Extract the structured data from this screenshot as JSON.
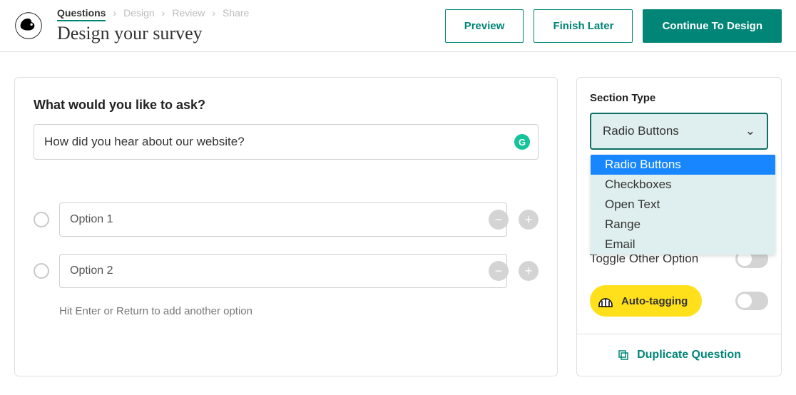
{
  "breadcrumb": {
    "steps": [
      "Questions",
      "Design",
      "Review",
      "Share"
    ],
    "active": 0
  },
  "title": "Design your survey",
  "actions": {
    "preview": "Preview",
    "later": "Finish Later",
    "continue": "Continue To Design"
  },
  "main": {
    "question_label": "What would you like to ask?",
    "question_value": "How did you hear about our website?",
    "options": [
      "Option 1",
      "Option 2"
    ],
    "hint": "Hit Enter or Return to add another option"
  },
  "side": {
    "section_type_label": "Section Type",
    "selected": "Radio Buttons",
    "items": [
      "Radio Buttons",
      "Checkboxes",
      "Open Text",
      "Range",
      "Email"
    ],
    "toggle_other": "Toggle Other Option",
    "auto_tag": "Auto-tagging",
    "duplicate": "Duplicate Question"
  }
}
